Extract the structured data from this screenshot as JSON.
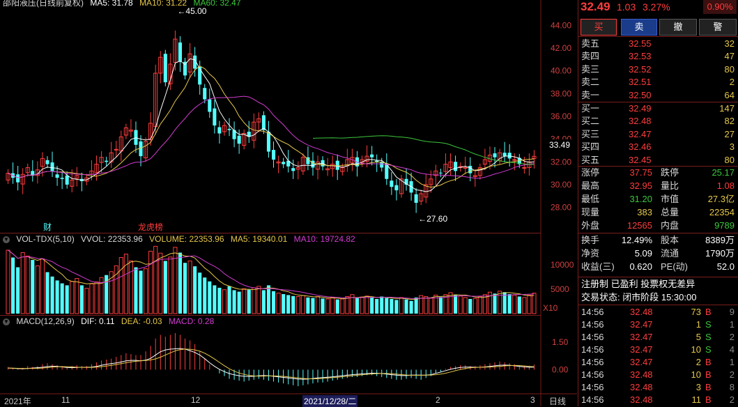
{
  "main_header": {
    "title": "邵阳液压(日线前复权)",
    "ma5": "MA5: 31.78",
    "ma10": "MA10: 31.22",
    "ma60": "MA60: 32.47",
    "high_marker": "45.00",
    "low_marker": "27.60",
    "badge_cai": "财",
    "badge_lhb": "龙虎榜",
    "last_price_tag": "33.49"
  },
  "price_axis": [
    "44.00",
    "42.00",
    "40.00",
    "38.00",
    "36.00",
    "34.00",
    "32.00",
    "30.00",
    "28.00"
  ],
  "volume_header": {
    "label": "VOL-TDX(5,10)",
    "vvol": "VVOL: 22353.96",
    "volume": "VOLUME: 22353.96",
    "ma5": "MA5: 19340.01",
    "ma10": "MA10: 19724.82"
  },
  "volume_axis": [
    "10000",
    "5000",
    "X10"
  ],
  "macd_header": {
    "label": "MACD(12,26,9)",
    "dif": "DIF: 0.11",
    "dea": "DEA: -0.03",
    "macd": "MACD: 0.28"
  },
  "macd_axis": [
    "1.50",
    "0.00"
  ],
  "x_axis": {
    "labels": [
      "2021年",
      "11",
      "12",
      "2021/12/28/二",
      "2",
      "3"
    ],
    "period": "日线"
  },
  "quote": {
    "price": "32.49",
    "change": "1.03",
    "pct": "3.27%",
    "extra": "0.90%"
  },
  "buttons": [
    "买",
    "卖",
    "撤",
    "警"
  ],
  "asks": [
    {
      "label": "卖五",
      "price": "32.55",
      "vol": "32"
    },
    {
      "label": "卖四",
      "price": "32.53",
      "vol": "47"
    },
    {
      "label": "卖三",
      "price": "32.52",
      "vol": "80"
    },
    {
      "label": "卖二",
      "price": "32.51",
      "vol": "2"
    },
    {
      "label": "卖一",
      "price": "32.50",
      "vol": "64"
    }
  ],
  "bids": [
    {
      "label": "买一",
      "price": "32.49",
      "vol": "147"
    },
    {
      "label": "买二",
      "price": "32.48",
      "vol": "82"
    },
    {
      "label": "买三",
      "price": "32.47",
      "vol": "27"
    },
    {
      "label": "买四",
      "price": "32.46",
      "vol": "3"
    },
    {
      "label": "买五",
      "price": "32.45",
      "vol": "80"
    }
  ],
  "stats": [
    {
      "k1": "涨停",
      "v1": "37.75",
      "k2": "跌停",
      "v2": "25.17"
    },
    {
      "k1": "最高",
      "v1": "32.95",
      "k2": "量比",
      "v2": "1.08"
    },
    {
      "k1": "最低",
      "v1": "31.20",
      "k2": "市值",
      "v2": "27.3亿"
    },
    {
      "k1": "现量",
      "v1": "383",
      "k2": "总量",
      "v2": "22354"
    },
    {
      "k1": "外盘",
      "v1": "12565",
      "k2": "内盘",
      "v2": "9789"
    }
  ],
  "stats2": [
    {
      "k1": "换手",
      "v1": "12.49%",
      "k2": "股本",
      "v2": "8389万"
    },
    {
      "k1": "净资",
      "v1": "5.09",
      "k2": "流通",
      "v2": "1790万"
    },
    {
      "k1": "收益(三)",
      "v1": "0.620",
      "k2": "PE(动)",
      "v2": "52.0"
    }
  ],
  "tags": "注册制 已盈利 投票权无差异",
  "trade_status": "交易状态: 闭市阶段 15:30:00",
  "ticks": [
    {
      "time": "14:56",
      "price": "32.48",
      "vol": "73",
      "side": "B",
      "n": "9"
    },
    {
      "time": "14:56",
      "price": "32.47",
      "vol": "1",
      "side": "S",
      "n": "1"
    },
    {
      "time": "14:56",
      "price": "32.47",
      "vol": "5",
      "side": "S",
      "n": "2"
    },
    {
      "time": "14:56",
      "price": "32.47",
      "vol": "10",
      "side": "S",
      "n": "4"
    },
    {
      "time": "14:56",
      "price": "32.47",
      "vol": "2",
      "side": "B",
      "n": "1"
    },
    {
      "time": "14:56",
      "price": "32.48",
      "vol": "10",
      "side": "B",
      "n": "2"
    },
    {
      "time": "14:56",
      "price": "32.48",
      "vol": "3",
      "side": "B",
      "n": "8"
    },
    {
      "time": "14:56",
      "price": "32.48",
      "vol": "11",
      "side": "B",
      "n": "2"
    }
  ],
  "colors": {
    "up": "#ff3d3d",
    "down": "#54ffff",
    "ma5": "#ffffff",
    "ma10": "#e6c84a",
    "ma20": "#d23cd2",
    "ma60": "#3cc83c"
  },
  "chart_data": {
    "type": "candlestick",
    "price_range": [
      26.5,
      45.5
    ],
    "closes": [
      31.0,
      30.6,
      30.2,
      30.9,
      31.5,
      30.8,
      31.3,
      32.3,
      31.8,
      31.2,
      30.6,
      30.5,
      30.0,
      30.4,
      30.8,
      30.3,
      30.6,
      31.2,
      31.8,
      32.4,
      32.0,
      32.8,
      33.1,
      34.2,
      35.0,
      34.8,
      33.5,
      32.5,
      33.8,
      35.4,
      39.8,
      41.2,
      39.0,
      40.6,
      42.8,
      40.8,
      39.6,
      41.5,
      40.2,
      38.8,
      37.5,
      36.4,
      35.2,
      34.5,
      35.2,
      34.8,
      34.0,
      33.6,
      34.5,
      34.2,
      35.5,
      35.8,
      34.8,
      32.9,
      32.2,
      32.0,
      31.8,
      31.6,
      31.2,
      31.5,
      32.4,
      31.8,
      31.5,
      32.0,
      31.6,
      31.4,
      31.8,
      31.3,
      31.5,
      32.2,
      32.4,
      31.6,
      32.2,
      32.5,
      32.4,
      32.0,
      31.5,
      30.5,
      29.8,
      29.5,
      30.5,
      30.0,
      29.3,
      28.4,
      29.2,
      30.0,
      30.5,
      31.2,
      31.0,
      31.8,
      32.0,
      31.2,
      31.6,
      31.5,
      31.0,
      30.8,
      31.5,
      32.2,
      32.6,
      32.4,
      32.8,
      32.5,
      32.3,
      32.2,
      31.8,
      31.5,
      32.0,
      32.49
    ],
    "volume_range": [
      0,
      14000
    ],
    "volumes": [
      13000,
      11500,
      9500,
      12500,
      11800,
      11000,
      9800,
      11200,
      8500,
      7600,
      6800,
      6200,
      5800,
      6600,
      7200,
      5800,
      5200,
      6100,
      6500,
      7400,
      7900,
      8600,
      9800,
      11500,
      12200,
      10800,
      9500,
      8800,
      9200,
      12800,
      13800,
      12400,
      10800,
      11600,
      13600,
      12500,
      10400,
      10800,
      9700,
      8400,
      7400,
      6600,
      5800,
      5300,
      4900,
      5600,
      4800,
      4500,
      5100,
      4900,
      5300,
      5600,
      4800,
      5800,
      4600,
      4200,
      4000,
      3800,
      3600,
      3500,
      3700,
      3300,
      3200,
      3500,
      3100,
      3000,
      3300,
      2900,
      3000,
      3500,
      3900,
      3200,
      3400,
      3600,
      3300,
      3000,
      3500,
      3200,
      3000,
      2800,
      3300,
      2900,
      2600,
      3300,
      3700,
      3500,
      3200,
      3800,
      3400,
      3900,
      4300,
      3900,
      3600,
      3300,
      3000,
      3100,
      3500,
      3900,
      4400,
      4100,
      4600,
      4400,
      4000,
      3800,
      3500,
      3300,
      3800,
      4200
    ],
    "macd_range": [
      -1.2,
      2.3
    ],
    "macd": [
      0.15,
      0.1,
      0.05,
      0.1,
      0.2,
      0.15,
      0.2,
      0.3,
      0.35,
      0.3,
      0.25,
      0.2,
      0.15,
      0.2,
      0.25,
      0.2,
      0.2,
      0.3,
      0.4,
      0.5,
      0.55,
      0.6,
      0.7,
      0.8,
      0.9,
      0.85,
      0.8,
      0.8,
      1.0,
      1.3,
      1.7,
      1.9,
      1.8,
      1.9,
      2.0,
      1.9,
      1.7,
      1.6,
      1.4,
      1.0,
      0.6,
      0.3,
      0.0,
      -0.2,
      -0.35,
      -0.5,
      -0.55,
      -0.6,
      -0.65,
      -0.6,
      -0.55,
      -0.5,
      -0.55,
      -0.6,
      -0.65,
      -0.7,
      -0.75,
      -0.8,
      -0.85,
      -0.9,
      -0.85,
      -0.8,
      -0.75,
      -0.7,
      -0.7,
      -0.65,
      -0.6,
      -0.55,
      -0.5,
      -0.45,
      -0.4,
      -0.4,
      -0.35,
      -0.3,
      -0.3,
      -0.35,
      -0.4,
      -0.45,
      -0.5,
      -0.55,
      -0.55,
      -0.5,
      -0.45,
      -0.5,
      -0.55,
      -0.45,
      -0.35,
      -0.2,
      -0.1,
      0.05,
      0.15,
      0.2,
      0.25,
      0.25,
      0.2,
      0.2,
      0.25,
      0.3,
      0.35,
      0.4,
      0.45,
      0.4,
      0.35,
      0.3,
      0.25,
      0.2,
      0.22,
      0.28
    ]
  }
}
